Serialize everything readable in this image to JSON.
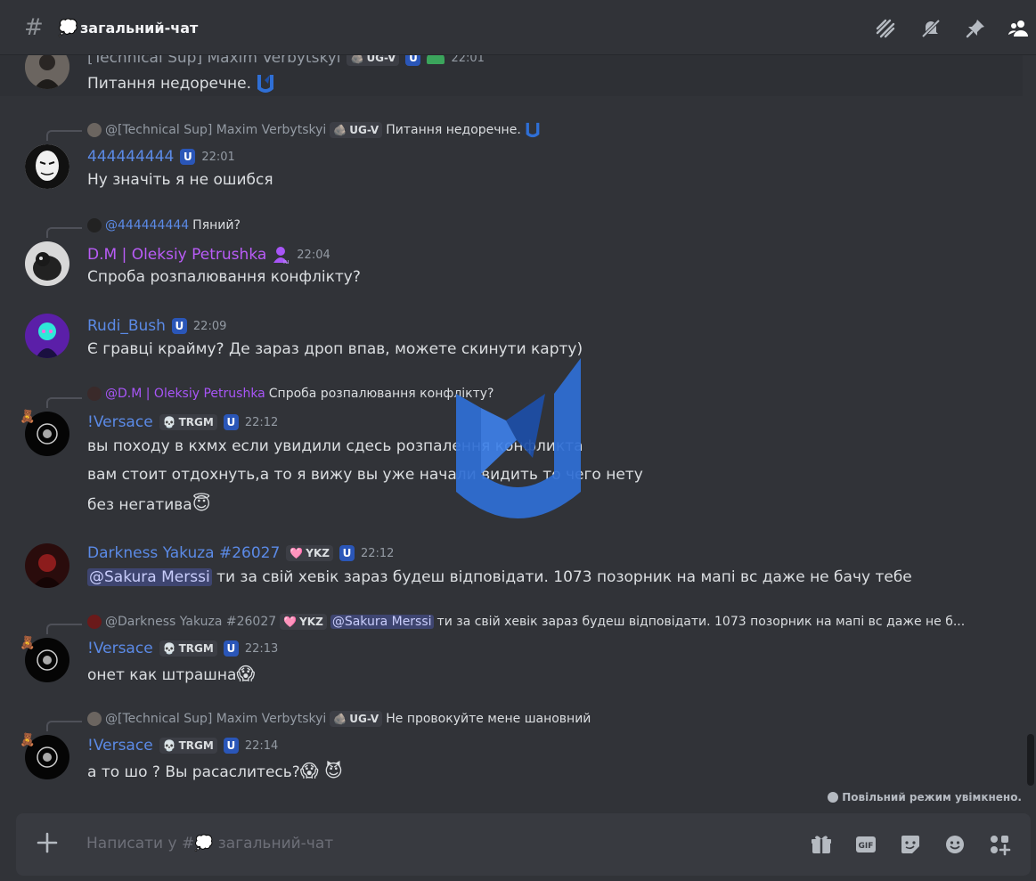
{
  "channel": {
    "hash": "#",
    "emoji": "💭",
    "name": "загальний-чат"
  },
  "messages": [
    {
      "user": "[Technical Sup] Maxim Verbytskyi",
      "tag": "UG-V",
      "tag_emoji": "🪨",
      "time": "22:01",
      "text": "Питання недоречне."
    },
    {
      "reply_user": "@[Technical Sup] Maxim Verbytskyi",
      "reply_tag": "UG-V",
      "reply_text": "Питання недоречне.",
      "user": "444444444",
      "time": "22:01",
      "text": "Ну значіть я не ошибся"
    },
    {
      "reply_user": "@444444444",
      "reply_text": "Пяний?",
      "user": "D.M | Oleksiy Petrushka",
      "time": "22:04",
      "text": "Спроба розпалювання конфлікту?"
    },
    {
      "user": "Rudi_Bush",
      "time": "22:09",
      "text": "Є гравці крайму? Де зараз дроп впав, можете скинути карту)"
    },
    {
      "reply_user": "@D.M | Oleksiy Petrushka",
      "reply_text": "Спроба розпалювання конфлікту?",
      "user": "!Versace",
      "tag": "TRGM",
      "tag_emoji": "💀",
      "time": "22:12",
      "lines": [
        "вы походу в кхмх если увидили сдесь розпалення конфликта",
        "вам стоит отдохнуть,а то я вижу вы уже начали видить то чего нету",
        "без негатива"
      ],
      "line3_emoji": "😇"
    },
    {
      "user": "Darkness Yakuza #26027",
      "tag": "YKZ",
      "tag_emoji": "🩷",
      "time": "22:12",
      "mention": "@Sakura Merssi",
      "text": "ти за свій хевік зараз будеш відповідати. 1073 позорник на мапі вс даже не бачу тебе"
    },
    {
      "reply_user": "@Darkness Yakuza #26027",
      "reply_tag": "YKZ",
      "reply_mention": "@Sakura Merssi",
      "reply_text": "ти за свій хевік зараз будеш відповідати. 1073 позорник на мапі вс даже не б...",
      "user": "!Versace",
      "tag": "TRGM",
      "time": "22:13",
      "text": "онет как штрашна",
      "text_emoji": "😱"
    },
    {
      "reply_user": "@[Technical Sup] Maxim Verbytskyi",
      "reply_tag": "UG-V",
      "reply_text": "Не провокуйте мене шановний",
      "user": "!Versace",
      "tag": "TRGM",
      "time": "22:14",
      "text": "а то шо ? Вы расаслитесь?",
      "text_emoji": "😱 😈"
    }
  ],
  "badge_letter": "U",
  "slowmode": "Повільний режим увімкнено.",
  "composer": {
    "placeholder": "Написати у #💭 загальний-чат",
    "gif": "GIF"
  },
  "colors": {
    "bg": "#313338",
    "link_blue": "#5b8ae6",
    "role_purple": "#b95cf7",
    "badge_blue": "#2a56b8"
  }
}
